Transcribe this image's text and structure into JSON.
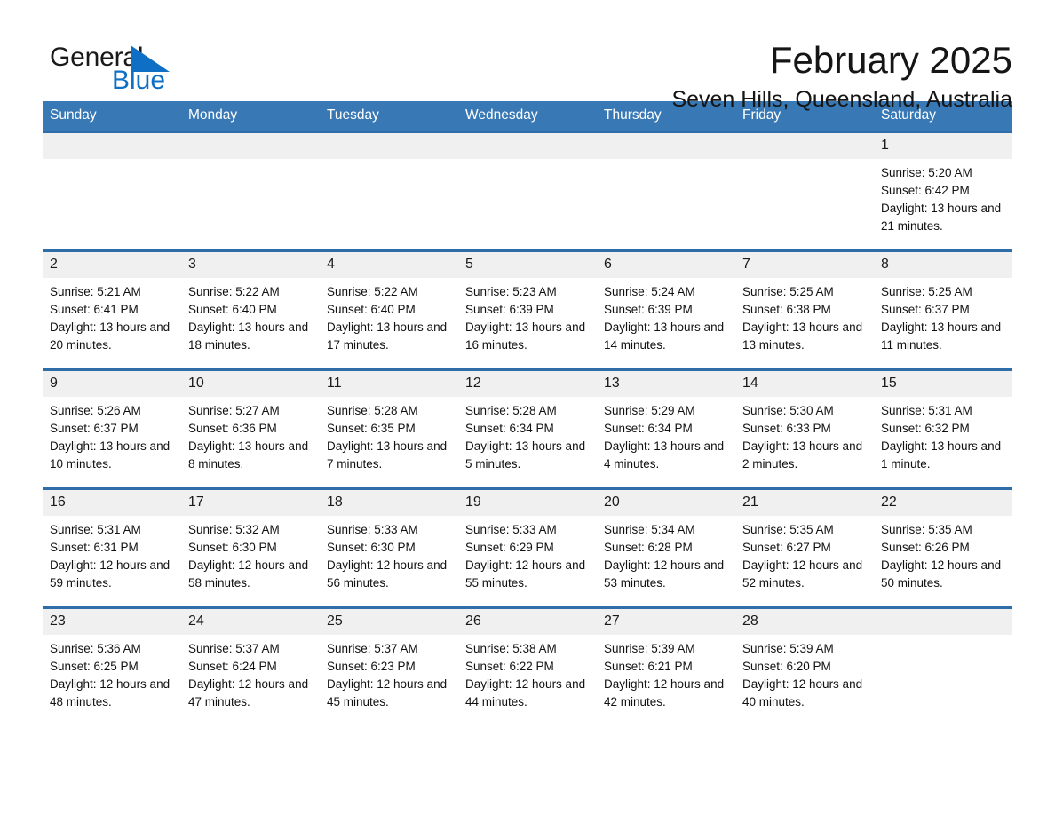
{
  "logo": {
    "word_one": "General",
    "word_two": "Blue",
    "flag_color": "#0f6fc5",
    "text_color": "#1a1a1a"
  },
  "header": {
    "month_title": "February 2025",
    "location": "Seven Hills, Queensland, Australia"
  },
  "theme": {
    "header_band": "#3878b4",
    "row_divider": "#2f6da8",
    "daynum_band": "#f0f0f0",
    "page_background": "#ffffff"
  },
  "weekdays": [
    "Sunday",
    "Monday",
    "Tuesday",
    "Wednesday",
    "Thursday",
    "Friday",
    "Saturday"
  ],
  "labels": {
    "sunrise_prefix": "Sunrise:",
    "sunset_prefix": "Sunset:",
    "daylight_prefix": "Daylight:"
  },
  "weeks": [
    [
      {
        "day": "",
        "empty": true
      },
      {
        "day": "",
        "empty": true
      },
      {
        "day": "",
        "empty": true
      },
      {
        "day": "",
        "empty": true
      },
      {
        "day": "",
        "empty": true
      },
      {
        "day": "",
        "empty": true
      },
      {
        "day": "1",
        "sunrise": "Sunrise: 5:20 AM",
        "sunset": "Sunset: 6:42 PM",
        "daylight": "Daylight: 13 hours and 21 minutes."
      }
    ],
    [
      {
        "day": "2",
        "sunrise": "Sunrise: 5:21 AM",
        "sunset": "Sunset: 6:41 PM",
        "daylight": "Daylight: 13 hours and 20 minutes."
      },
      {
        "day": "3",
        "sunrise": "Sunrise: 5:22 AM",
        "sunset": "Sunset: 6:40 PM",
        "daylight": "Daylight: 13 hours and 18 minutes."
      },
      {
        "day": "4",
        "sunrise": "Sunrise: 5:22 AM",
        "sunset": "Sunset: 6:40 PM",
        "daylight": "Daylight: 13 hours and 17 minutes."
      },
      {
        "day": "5",
        "sunrise": "Sunrise: 5:23 AM",
        "sunset": "Sunset: 6:39 PM",
        "daylight": "Daylight: 13 hours and 16 minutes."
      },
      {
        "day": "6",
        "sunrise": "Sunrise: 5:24 AM",
        "sunset": "Sunset: 6:39 PM",
        "daylight": "Daylight: 13 hours and 14 minutes."
      },
      {
        "day": "7",
        "sunrise": "Sunrise: 5:25 AM",
        "sunset": "Sunset: 6:38 PM",
        "daylight": "Daylight: 13 hours and 13 minutes."
      },
      {
        "day": "8",
        "sunrise": "Sunrise: 5:25 AM",
        "sunset": "Sunset: 6:37 PM",
        "daylight": "Daylight: 13 hours and 11 minutes."
      }
    ],
    [
      {
        "day": "9",
        "sunrise": "Sunrise: 5:26 AM",
        "sunset": "Sunset: 6:37 PM",
        "daylight": "Daylight: 13 hours and 10 minutes."
      },
      {
        "day": "10",
        "sunrise": "Sunrise: 5:27 AM",
        "sunset": "Sunset: 6:36 PM",
        "daylight": "Daylight: 13 hours and 8 minutes."
      },
      {
        "day": "11",
        "sunrise": "Sunrise: 5:28 AM",
        "sunset": "Sunset: 6:35 PM",
        "daylight": "Daylight: 13 hours and 7 minutes."
      },
      {
        "day": "12",
        "sunrise": "Sunrise: 5:28 AM",
        "sunset": "Sunset: 6:34 PM",
        "daylight": "Daylight: 13 hours and 5 minutes."
      },
      {
        "day": "13",
        "sunrise": "Sunrise: 5:29 AM",
        "sunset": "Sunset: 6:34 PM",
        "daylight": "Daylight: 13 hours and 4 minutes."
      },
      {
        "day": "14",
        "sunrise": "Sunrise: 5:30 AM",
        "sunset": "Sunset: 6:33 PM",
        "daylight": "Daylight: 13 hours and 2 minutes."
      },
      {
        "day": "15",
        "sunrise": "Sunrise: 5:31 AM",
        "sunset": "Sunset: 6:32 PM",
        "daylight": "Daylight: 13 hours and 1 minute."
      }
    ],
    [
      {
        "day": "16",
        "sunrise": "Sunrise: 5:31 AM",
        "sunset": "Sunset: 6:31 PM",
        "daylight": "Daylight: 12 hours and 59 minutes."
      },
      {
        "day": "17",
        "sunrise": "Sunrise: 5:32 AM",
        "sunset": "Sunset: 6:30 PM",
        "daylight": "Daylight: 12 hours and 58 minutes."
      },
      {
        "day": "18",
        "sunrise": "Sunrise: 5:33 AM",
        "sunset": "Sunset: 6:30 PM",
        "daylight": "Daylight: 12 hours and 56 minutes."
      },
      {
        "day": "19",
        "sunrise": "Sunrise: 5:33 AM",
        "sunset": "Sunset: 6:29 PM",
        "daylight": "Daylight: 12 hours and 55 minutes."
      },
      {
        "day": "20",
        "sunrise": "Sunrise: 5:34 AM",
        "sunset": "Sunset: 6:28 PM",
        "daylight": "Daylight: 12 hours and 53 minutes."
      },
      {
        "day": "21",
        "sunrise": "Sunrise: 5:35 AM",
        "sunset": "Sunset: 6:27 PM",
        "daylight": "Daylight: 12 hours and 52 minutes."
      },
      {
        "day": "22",
        "sunrise": "Sunrise: 5:35 AM",
        "sunset": "Sunset: 6:26 PM",
        "daylight": "Daylight: 12 hours and 50 minutes."
      }
    ],
    [
      {
        "day": "23",
        "sunrise": "Sunrise: 5:36 AM",
        "sunset": "Sunset: 6:25 PM",
        "daylight": "Daylight: 12 hours and 48 minutes."
      },
      {
        "day": "24",
        "sunrise": "Sunrise: 5:37 AM",
        "sunset": "Sunset: 6:24 PM",
        "daylight": "Daylight: 12 hours and 47 minutes."
      },
      {
        "day": "25",
        "sunrise": "Sunrise: 5:37 AM",
        "sunset": "Sunset: 6:23 PM",
        "daylight": "Daylight: 12 hours and 45 minutes."
      },
      {
        "day": "26",
        "sunrise": "Sunrise: 5:38 AM",
        "sunset": "Sunset: 6:22 PM",
        "daylight": "Daylight: 12 hours and 44 minutes."
      },
      {
        "day": "27",
        "sunrise": "Sunrise: 5:39 AM",
        "sunset": "Sunset: 6:21 PM",
        "daylight": "Daylight: 12 hours and 42 minutes."
      },
      {
        "day": "28",
        "sunrise": "Sunrise: 5:39 AM",
        "sunset": "Sunset: 6:20 PM",
        "daylight": "Daylight: 12 hours and 40 minutes."
      },
      {
        "day": "",
        "empty": true
      }
    ]
  ]
}
